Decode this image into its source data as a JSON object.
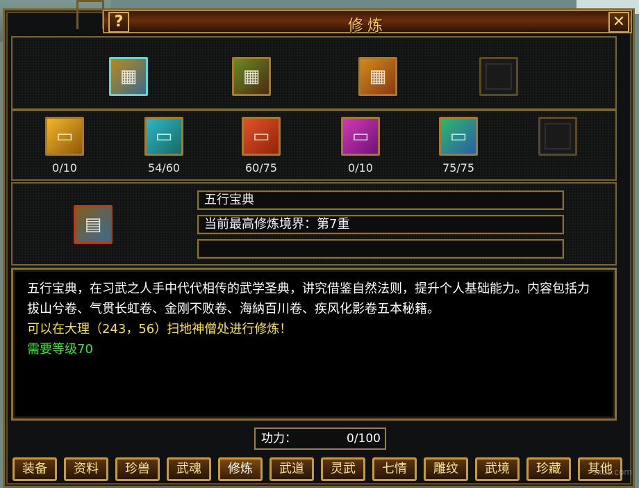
{
  "window": {
    "title": "修炼",
    "help_label": "?",
    "close_label": "✕"
  },
  "top_icons": [
    {
      "name": "icon-book-golden",
      "colors": [
        "#b7891f",
        "#3d6b8b"
      ],
      "selected": true
    },
    {
      "name": "icon-scroll-bundle",
      "colors": [
        "#6a8a22",
        "#4c2b12"
      ],
      "selected": false
    },
    {
      "name": "icon-gold-scroll",
      "colors": [
        "#d18a1e",
        "#8b3a10"
      ],
      "selected": false
    },
    {
      "name": "icon-empty-slot",
      "colors": [],
      "selected": false
    }
  ],
  "books": [
    {
      "name": "book-yellow",
      "count": "0/10",
      "colors": [
        "#f1b52a",
        "#8f5a08"
      ]
    },
    {
      "name": "book-cyan",
      "count": "54/60",
      "colors": [
        "#2fb6c9",
        "#176b62"
      ]
    },
    {
      "name": "book-red",
      "count": "60/75",
      "colors": [
        "#e5502a",
        "#8f2508"
      ]
    },
    {
      "name": "book-magenta",
      "count": "0/10",
      "colors": [
        "#d13ab3",
        "#6f127a"
      ]
    },
    {
      "name": "book-green",
      "count": "75/75",
      "colors": [
        "#2fb86a",
        "#2a5fa8"
      ]
    },
    {
      "name": "book-empty",
      "count": "",
      "colors": []
    }
  ],
  "detail": {
    "name_field": "五行宝典",
    "realm_field": "当前最高修炼境界：第7重",
    "empty_field": ""
  },
  "description": {
    "text": "五行宝典，在习武之人手中代代相传的武学圣典，讲究借鉴自然法则，提升个人基础能力。内容包括力拔山兮卷、气贯长虹卷、金刚不败卷、海納百川卷、疾风化影卷五本秘籍。",
    "location": "可以在大理（243，56）扫地神僧处进行修炼！",
    "requirement": "需要等级70"
  },
  "power": {
    "label": "功力：",
    "value": "0/100"
  },
  "tabs": [
    "装备",
    "资料",
    "珍兽",
    "武魂",
    "修炼",
    "武道",
    "灵武",
    "七情",
    "雕纹",
    "武境",
    "珍藏",
    "其他"
  ],
  "active_tab": 4,
  "watermark": "sxds.com"
}
